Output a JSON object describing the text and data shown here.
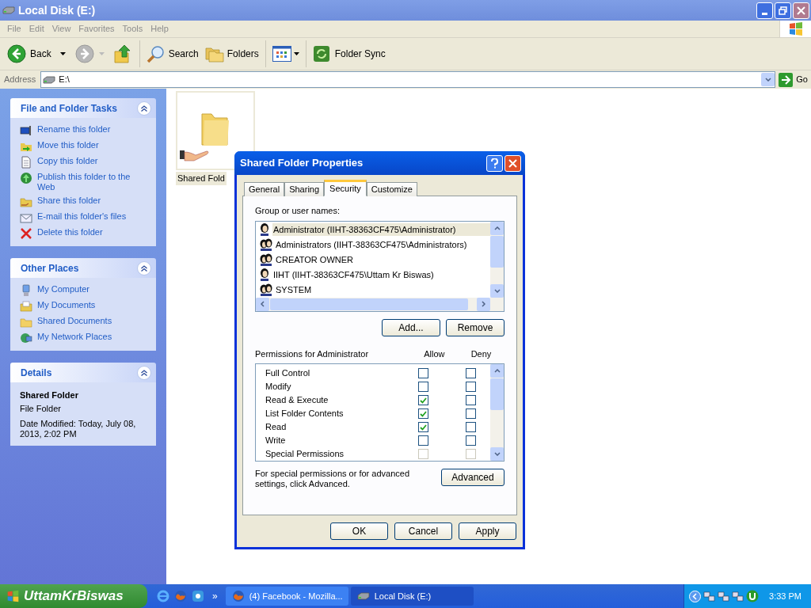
{
  "window": {
    "title": "Local Disk (E:)",
    "menu": [
      "File",
      "Edit",
      "View",
      "Favorites",
      "Tools",
      "Help"
    ],
    "toolbar": [
      {
        "kind": "back",
        "label": "Back",
        "disabled": false
      },
      {
        "kind": "forward",
        "disabled": true
      },
      {
        "kind": "up"
      },
      {
        "kind": "separator"
      },
      {
        "kind": "search",
        "label": "Search"
      },
      {
        "kind": "folders",
        "label": "Folders"
      },
      {
        "kind": "separator"
      },
      {
        "kind": "views"
      },
      {
        "kind": "separator"
      },
      {
        "kind": "sync",
        "label": "Folder Sync"
      }
    ],
    "address": {
      "label": "Address",
      "value": "E:\\"
    },
    "go": "Go"
  },
  "sidebar": {
    "panels": [
      {
        "title": "File and Folder Tasks",
        "items": [
          {
            "label": "Rename this folder"
          },
          {
            "label": "Move this folder"
          },
          {
            "label": "Copy this folder"
          },
          {
            "label": "Publish this folder to the Web"
          },
          {
            "label": "Share this folder"
          },
          {
            "label": "E-mail this folder's files"
          },
          {
            "label": "Delete this folder"
          }
        ]
      },
      {
        "title": "Other Places",
        "items": [
          {
            "label": "My Computer"
          },
          {
            "label": "My Documents"
          },
          {
            "label": "Shared Documents"
          },
          {
            "label": "My Network Places"
          }
        ]
      }
    ],
    "details": {
      "title": "Details",
      "name": "Shared Folder",
      "type": "File Folder",
      "modified": "Date Modified: Today, July 08, 2013, 2:02 PM"
    }
  },
  "files": [
    {
      "label": "Shared Fold",
      "selected": true
    }
  ],
  "dialog": {
    "title": "Shared Folder Properties",
    "tabs": [
      {
        "label": "General",
        "selected": false
      },
      {
        "label": "Sharing",
        "selected": false
      },
      {
        "label": "Security",
        "selected": true
      },
      {
        "label": "Customize",
        "selected": false
      }
    ],
    "group_label": "Group or user names:",
    "users": [
      {
        "name": "Administrator (IIHT-38363CF475\\Administrator)",
        "kind": "user",
        "selected": true
      },
      {
        "name": "Administrators (IIHT-38363CF475\\Administrators)",
        "kind": "group",
        "selected": false
      },
      {
        "name": "CREATOR OWNER",
        "kind": "group",
        "selected": false
      },
      {
        "name": "IIHT (IIHT-38363CF475\\Uttam Kr Biswas)",
        "kind": "user",
        "selected": false
      },
      {
        "name": "SYSTEM",
        "kind": "group",
        "selected": false
      }
    ],
    "add": "Add...",
    "remove": "Remove",
    "permissions_label": "Permissions for Administrator",
    "allow_label": "Allow",
    "deny_label": "Deny",
    "permissions": [
      {
        "name": "Full Control",
        "allow": false,
        "deny": false,
        "disabled": false
      },
      {
        "name": "Modify",
        "allow": false,
        "deny": false,
        "disabled": false
      },
      {
        "name": "Read & Execute",
        "allow": true,
        "deny": false,
        "disabled": false
      },
      {
        "name": "List Folder Contents",
        "allow": true,
        "deny": false,
        "disabled": false
      },
      {
        "name": "Read",
        "allow": true,
        "deny": false,
        "disabled": false
      },
      {
        "name": "Write",
        "allow": false,
        "deny": false,
        "disabled": false
      },
      {
        "name": "Special Permissions",
        "allow": false,
        "deny": false,
        "disabled": true
      }
    ],
    "advanced_note": "For special permissions or for advanced settings, click Advanced.",
    "advanced": "Advanced",
    "buttons": [
      "OK",
      "Cancel",
      "Apply"
    ]
  },
  "taskbar": {
    "start": "UttamKrBiswas",
    "more": "»",
    "tasks": [
      {
        "label": "(4) Facebook - Mozilla...",
        "kind": "browser",
        "selected": false
      },
      {
        "label": "Local Disk (E:)",
        "kind": "drive",
        "selected": true
      }
    ],
    "clock": "3:33 PM"
  }
}
